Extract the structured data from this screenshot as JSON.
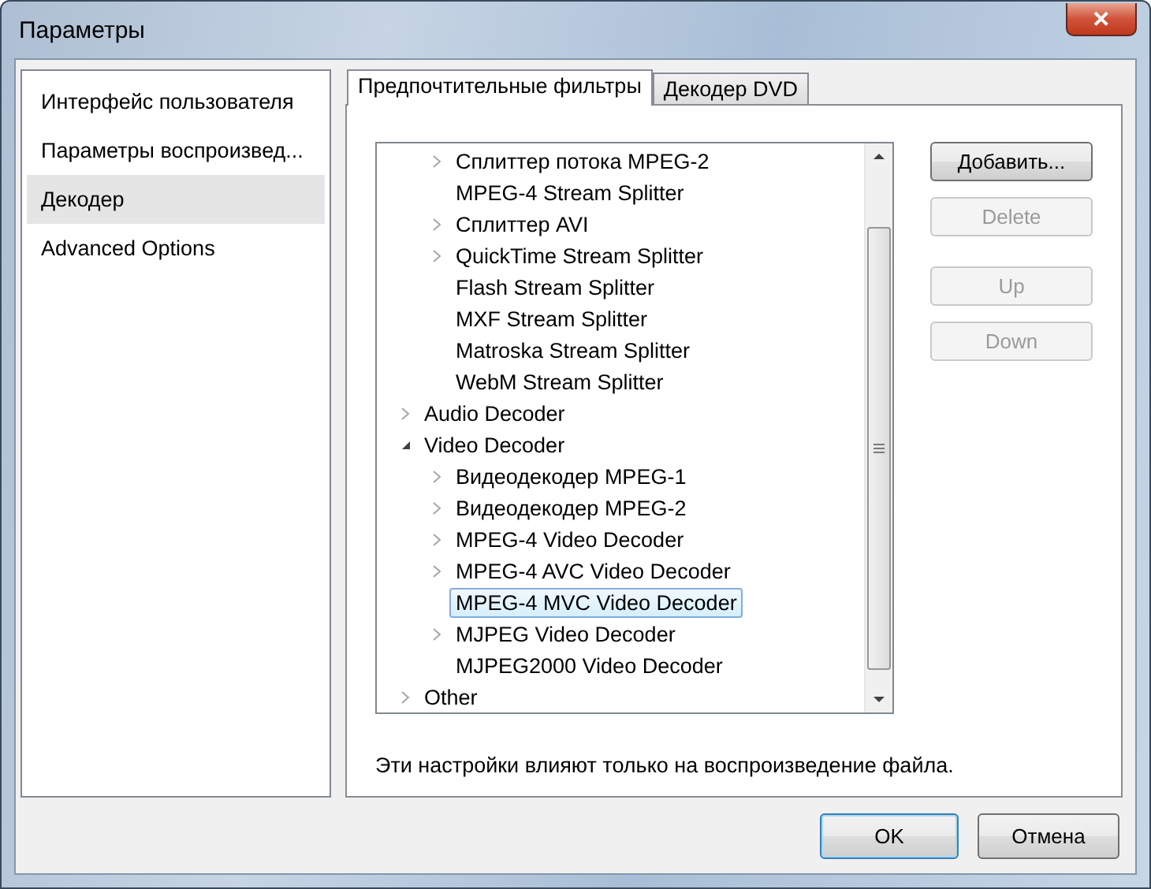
{
  "window": {
    "title": "Параметры",
    "close": "✕"
  },
  "sidebar": {
    "items": [
      {
        "label": "Интерфейс пользователя",
        "selected": false
      },
      {
        "label": "Параметры воспроизвед...",
        "selected": false
      },
      {
        "label": "Декодер",
        "selected": true
      },
      {
        "label": "Advanced Options",
        "selected": false
      }
    ]
  },
  "tabs": [
    {
      "label": "Предпочтительные фильтры",
      "selected": true
    },
    {
      "label": "Декодер DVD",
      "selected": false
    }
  ],
  "tree": {
    "items": [
      {
        "children": [
          {
            "label": "Сплиттер потока MPEG-2",
            "expandable": true,
            "expanded": false,
            "selected": false
          },
          {
            "label": "MPEG-4 Stream Splitter",
            "expandable": false,
            "selected": false
          },
          {
            "label": "Сплиттер AVI",
            "expandable": true,
            "expanded": false,
            "selected": false
          },
          {
            "label": "QuickTime Stream Splitter",
            "expandable": true,
            "expanded": false,
            "selected": false
          },
          {
            "label": "Flash Stream Splitter",
            "expandable": false,
            "selected": false
          },
          {
            "label": "MXF Stream Splitter",
            "expandable": false,
            "selected": false
          },
          {
            "label": "Matroska Stream Splitter",
            "expandable": false,
            "selected": false
          },
          {
            "label": "WebM Stream Splitter",
            "expandable": false,
            "selected": false
          }
        ]
      },
      {
        "label": "Audio Decoder",
        "expandable": true,
        "expanded": false,
        "selected": false
      },
      {
        "label": "Video Decoder",
        "expandable": true,
        "expanded": true,
        "selected": false,
        "children": [
          {
            "label": "Видеодекодер MPEG-1",
            "expandable": true,
            "expanded": false,
            "selected": false
          },
          {
            "label": "Видеодекодер MPEG-2",
            "expandable": true,
            "expanded": false,
            "selected": false
          },
          {
            "label": "MPEG-4 Video Decoder",
            "expandable": true,
            "expanded": false,
            "selected": false
          },
          {
            "label": "MPEG-4 AVC Video Decoder",
            "expandable": true,
            "expanded": false,
            "selected": false
          },
          {
            "label": "MPEG-4 MVC Video Decoder",
            "expandable": false,
            "selected": true
          },
          {
            "label": "MJPEG Video Decoder",
            "expandable": true,
            "expanded": false,
            "selected": false
          },
          {
            "label": "MJPEG2000 Video Decoder",
            "expandable": false,
            "selected": false
          }
        ]
      },
      {
        "label": "Other",
        "expandable": true,
        "expanded": false,
        "selected": false
      }
    ]
  },
  "side_buttons": [
    {
      "label": "Добавить...",
      "disabled": false
    },
    {
      "label": "Delete",
      "disabled": true
    },
    {
      "label": "Up",
      "disabled": true
    },
    {
      "label": "Down",
      "disabled": true
    }
  ],
  "note": "Эти настройки влияют только на воспроизведение файла.",
  "buttons": [
    {
      "label": "OK",
      "default": true
    },
    {
      "label": "Отмена",
      "default": false
    }
  ]
}
